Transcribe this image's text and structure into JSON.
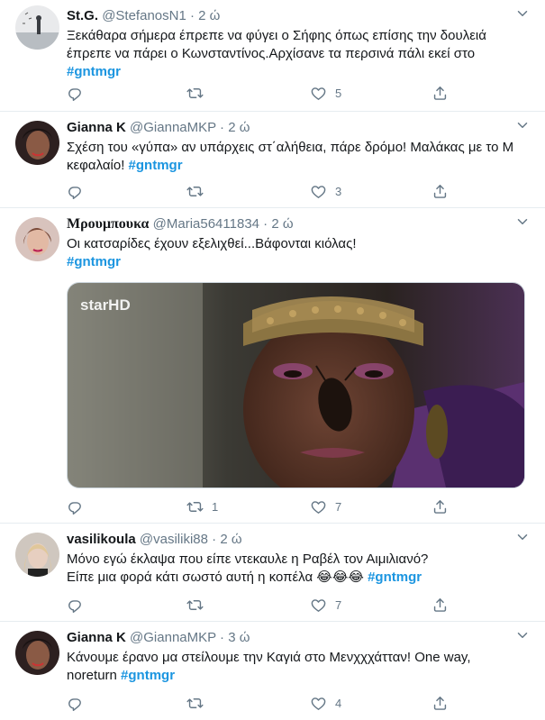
{
  "tweets": [
    {
      "name": "St.G.",
      "handle": "@StefanosN1",
      "dot": "·",
      "time": "2 ώ",
      "text": "Ξεκάθαρα σήμερα έπρεπε να φύγει ο Σήφης όπως επίσης την δουλειά έπρεπε να πάρει ο Κωνσταντίνος.Αρχίσανε τα περσινά πάλι εκεί στο",
      "hashtag": "#gntmgr",
      "replies": "",
      "retweets": "",
      "likes": "5"
    },
    {
      "name": "Gianna K",
      "handle": "@GiannaMKP",
      "dot": "·",
      "time": "2 ώ",
      "text": "Σχέση του «γύπα» αν υπάρχεις στ΄αλήθεια, πάρε δρόμο! Μαλάκας με το Μ κεφαλαίο!",
      "hashtag": "#gntmgr",
      "replies": "",
      "retweets": "",
      "likes": "3"
    },
    {
      "name": "Μρουμπουκα",
      "handle": "@Maria56411834",
      "dot": "·",
      "time": "2 ώ",
      "text": "Οι κατσαρίδες έχουν εξελιχθεί...Βάφονται κιόλας!",
      "hashtag": "#gntmgr",
      "media_logo": "starHD",
      "replies": "",
      "retweets": "1",
      "likes": "7"
    },
    {
      "name": "vasilikoula",
      "handle": "@vasiliki88",
      "dot": "·",
      "time": "2 ώ",
      "text_line1": "Μόνο εγώ έκλαψα που είπε ντεκαυλε η Ραβέλ τον Αιμιλιανό?",
      "text_line2": "Είπε μια φορά κάτι σωστό αυτή η κοπέλα",
      "emoji": "😂😂😂",
      "hashtag": "#gntmgr",
      "replies": "",
      "retweets": "",
      "likes": "7"
    },
    {
      "name": "Gianna K",
      "handle": "@GiannaMKP",
      "dot": "·",
      "time": "3 ώ",
      "text": "Κάνουμε έρανο μα στείλουμε την Καγιά στο Μενχχχάτταν! One way, noreturn",
      "hashtag": "#gntmgr",
      "replies": "",
      "retweets": "",
      "likes": "4"
    }
  ],
  "colors": {
    "hashtag": "#1b95e0",
    "secondary_text": "#657786",
    "border": "#e6ecf0"
  }
}
